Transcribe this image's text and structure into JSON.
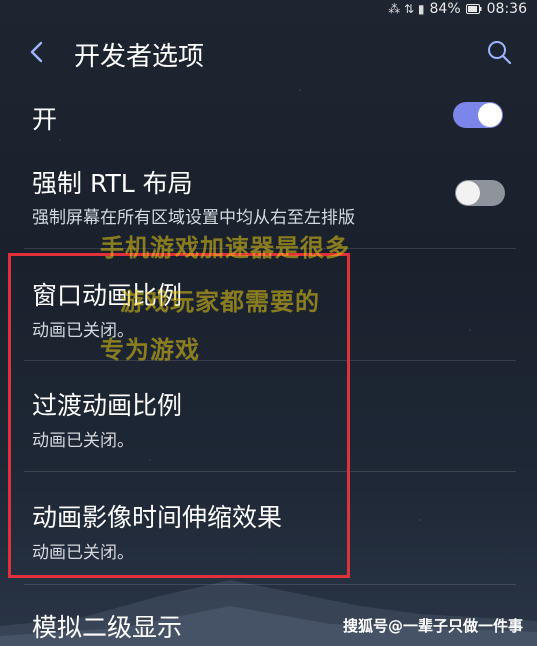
{
  "status_bar": {
    "signal_icons": "⁂ ⇅ ▮",
    "battery": "84%",
    "time": "08:36"
  },
  "header": {
    "title": "开发者选项"
  },
  "settings": {
    "master": {
      "label": "开",
      "toggle_state": "on"
    },
    "rtl": {
      "title": "强制 RTL 布局",
      "subtitle": "强制屏幕在所有区域设置中均从右至左排版",
      "toggle_state": "off"
    },
    "window_anim": {
      "title": "窗口动画比例",
      "subtitle": "动画已关闭。"
    },
    "transition_anim": {
      "title": "过渡动画比例",
      "subtitle": "动画已关闭。"
    },
    "animator_duration": {
      "title": "动画影像时间伸缩效果",
      "subtitle": "动画已关闭。"
    },
    "secondary_display": {
      "title": "模拟二级显示"
    }
  },
  "overlay": {
    "line1": "手机游戏加速器是很多",
    "line2": "游戏玩家都需要的",
    "line3": "专为游戏"
  },
  "watermark": "搜狐号@一辈子只做一件事",
  "colors": {
    "toggle_on": "#7c86e8",
    "toggle_off": "#8f939b",
    "highlight_border": "#e0313b"
  }
}
